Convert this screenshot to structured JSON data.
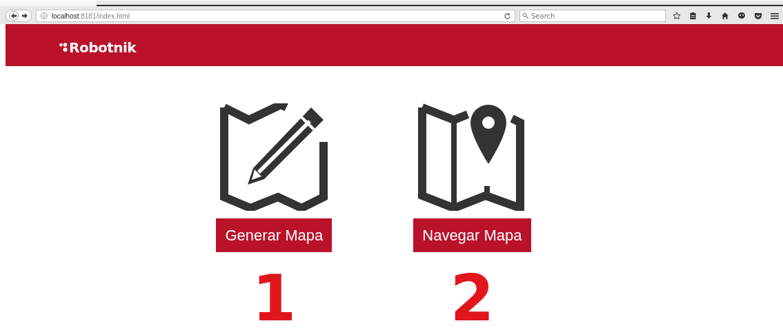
{
  "browser": {
    "url": "**localhost**:8181/index.html",
    "search": {
      "placeholder": "Search"
    }
  },
  "header": {
    "logo": "Robotnik"
  },
  "options": [
    {
      "kind": "edit-map",
      "label": "Generar Mapa",
      "number": "1"
    },
    {
      "kind": "pin-map",
      "label": "Navegar Mapa",
      "number": "2"
    }
  ]
}
